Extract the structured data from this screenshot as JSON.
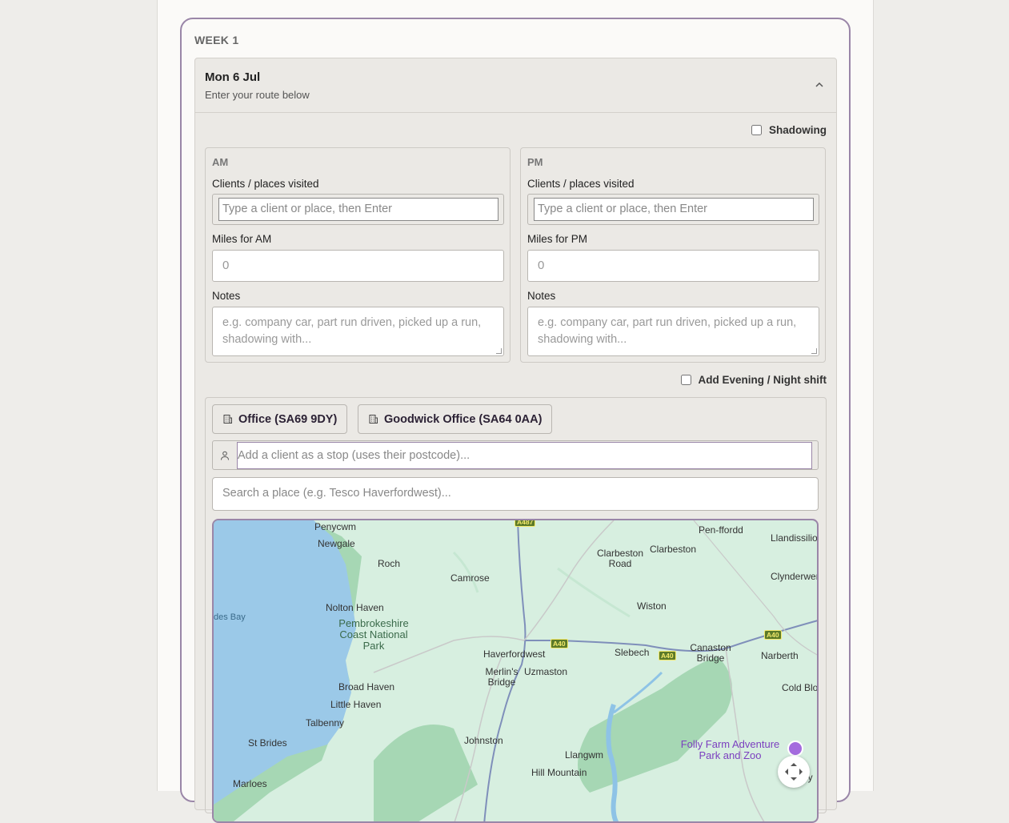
{
  "week": {
    "title": "WEEK 1"
  },
  "day": {
    "date": "Mon 6 Jul",
    "subtitle": "Enter your route below"
  },
  "shadowing": {
    "label": "Shadowing",
    "checked": false
  },
  "am": {
    "title": "AM",
    "clients_label": "Clients / places visited",
    "clients_placeholder": "Type a client or place, then Enter",
    "miles_label": "Miles for AM",
    "miles_placeholder": "0",
    "notes_label": "Notes",
    "notes_placeholder": "e.g. company car, part run driven, picked up a run, shadowing with..."
  },
  "pm": {
    "title": "PM",
    "clients_label": "Clients / places visited",
    "clients_placeholder": "Type a client or place, then Enter",
    "miles_label": "Miles for PM",
    "miles_placeholder": "0",
    "notes_label": "Notes",
    "notes_placeholder": "e.g. company car, part run driven, picked up a run, shadowing with..."
  },
  "evening": {
    "label": "Add Evening / Night shift",
    "checked": false
  },
  "route": {
    "chips": [
      "Office (SA69 9DY)",
      "Goodwick Office (SA64 0AA)"
    ],
    "stop_placeholder": "Add a client as a stop (uses their postcode)...",
    "place_placeholder": "Search a place (e.g. Tesco Haverfordwest)..."
  },
  "map": {
    "places": [
      "Penycwm",
      "Newgale",
      "Roch",
      "Camrose",
      "Clarbeston Road",
      "Clarbeston",
      "Pen-ffordd",
      "Llandissilio",
      "Clynderwen",
      "Wiston",
      "Nolton Haven",
      "Haverfordwest",
      "Slebech",
      "Canaston Bridge",
      "Narberth",
      "Merlin's Bridge",
      "Uzmaston",
      "Broad Haven",
      "Little Haven",
      "Talbenny",
      "St Brides",
      "Johnston",
      "Llangwm",
      "Hill Mountain",
      "Cold Blo",
      "Marloes",
      "des Bay",
      "ly"
    ],
    "park": "Pembrokeshire Coast National Park",
    "poi": "Folly Farm Adventure Park and Zoo",
    "roads": [
      "A40",
      "A40",
      "A40",
      "A487"
    ]
  },
  "colors": {
    "accent": "#9a86a8",
    "panel": "#ebe9e5",
    "sea": "#9bc9e8",
    "land": "#d7efe0",
    "park": "#a6d7b4"
  }
}
